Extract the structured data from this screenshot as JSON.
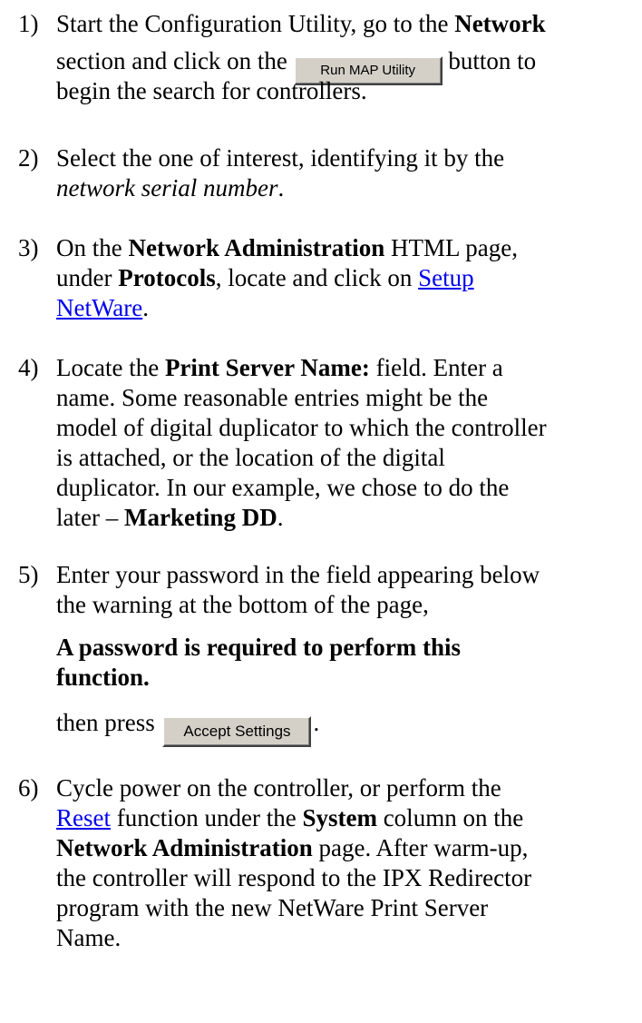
{
  "steps": [
    {
      "number": "1)",
      "line1_pre": "Start the Configuration Utility, go to the ",
      "line1_bold": "Network",
      "line2_pre": "section and click on the ",
      "button": "Run MAP Utility",
      "line2_post": " button to",
      "line3": "begin the search for controllers."
    },
    {
      "number": "2)",
      "line1": "Select the one of interest, identifying it by the",
      "line2_italic": "network serial number",
      "line2_post": "."
    },
    {
      "number": "3)",
      "line1_pre": "On the ",
      "line1_bold": "Network Administration",
      "line1_post": " HTML page,",
      "line2_pre": "under ",
      "line2_bold": "Protocols",
      "line2_mid": ", locate and click on ",
      "link_part1": "Setup",
      "link_part2": "NetWare",
      "line3_post": "."
    },
    {
      "number": "4)",
      "line1_pre": "Locate the ",
      "line1_bold": "Print Server Name:",
      "line1_post": " field.  Enter a",
      "line2": "name.  Some reasonable entries might be the",
      "line3": "model of digital duplicator to which the controller",
      "line4": "is attached, or the location of the digital",
      "line5": "duplicator.  In our example, we chose to do the",
      "line6_pre": "later – ",
      "line6_bold": "Marketing DD",
      "line6_post": "."
    },
    {
      "number": "5)",
      "line1": "Enter your password in the field appearing below",
      "line2": "the warning at the bottom of the page,",
      "warning_line1": "A password is required to perform this",
      "warning_line2": "function.",
      "then_press": "then press ",
      "button": "Accept Settings",
      "post": "."
    },
    {
      "number": "6)",
      "line1": "Cycle power on the controller, or perform the",
      "line2_link": "Reset",
      "line2_mid": " function under the ",
      "line2_bold": "System",
      "line2_post": " column on the",
      "line3_bold": "Network Administration",
      "line3_post": " page.  After warm-up,",
      "line4": "the controller will respond to the IPX Redirector",
      "line5": "program with the new NetWare Print Server",
      "line6": "Name."
    }
  ]
}
